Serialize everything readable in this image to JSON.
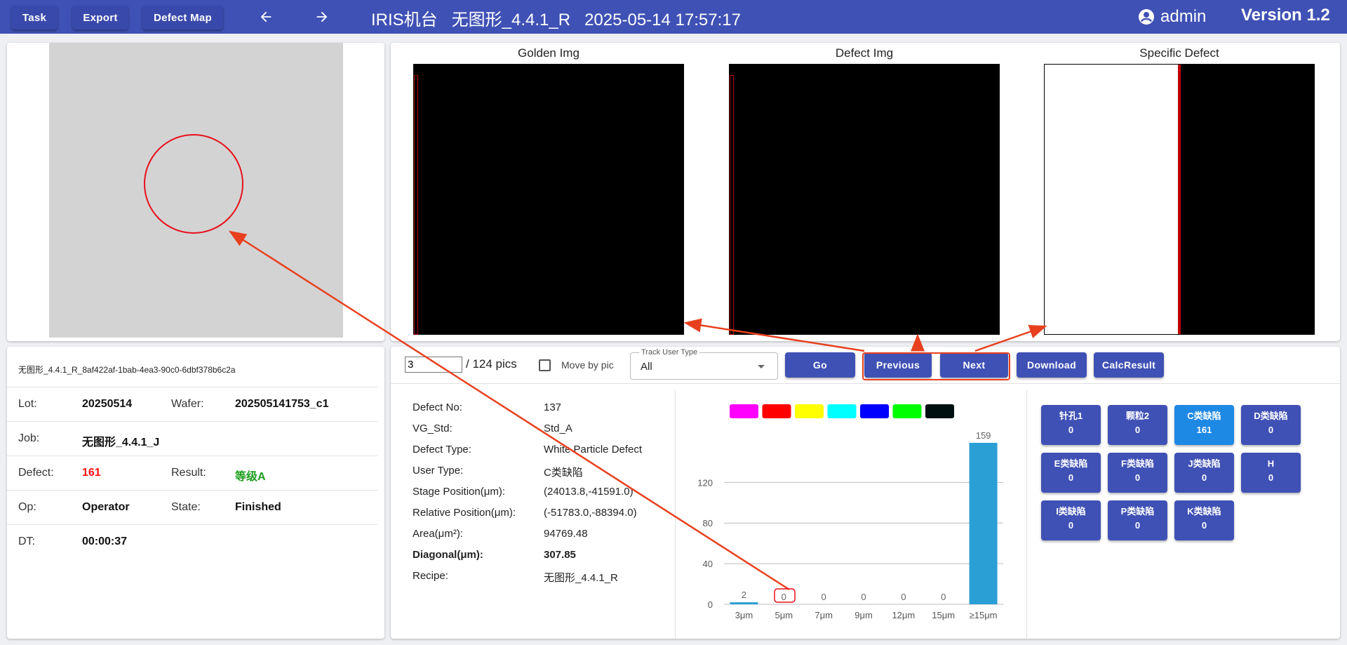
{
  "topbar": {
    "task_label": "Task",
    "export_label": "Export",
    "defect_map_label": "Defect Map",
    "title": "IRIS机台   无图形_4.4.1_R   2025-05-14 17:57:17",
    "user": "admin",
    "version": "Version 1.2"
  },
  "images": {
    "golden_title": "Golden Img",
    "defect_title": "Defect Img",
    "specific_title": "Specific Defect"
  },
  "info": {
    "file_id": "无图形_4.4.1_R_8af422af-1bab-4ea3-90c0-6dbf378b6c2a",
    "lot_label": "Lot:",
    "lot": "20250514",
    "wafer_label": "Wafer:",
    "wafer": "202505141753_c1",
    "job_label": "Job:",
    "job": "无图形_4.4.1_J",
    "defect_label": "Defect:",
    "defect": "161",
    "result_label": "Result:",
    "result": "等级A",
    "op_label": "Op:",
    "op": "Operator",
    "state_label": "State:",
    "state": "Finished",
    "dt_label": "DT:",
    "dt": "00:00:37"
  },
  "controls": {
    "page_value": "3",
    "total_label": "/ 124 pics",
    "move_by_pic_label": "Move by pic",
    "track_user_type_label": "Track User Type",
    "track_user_type_value": "All",
    "go_label": "Go",
    "previous_label": "Previous",
    "next_label": "Next",
    "download_label": "Download",
    "calc_label": "CalcResult"
  },
  "defect": {
    "no_label": "Defect No:",
    "no": "137",
    "vg_label": "VG_Std:",
    "vg": "Std_A",
    "type_label": "Defect Type:",
    "type": "White Particle Defect",
    "user_type_label": "User Type:",
    "user_type": "C类缺陷",
    "stage_label": "Stage Position(μm):",
    "stage": "(24013.8,-41591.0)",
    "relative_label": "Relative Position(μm):",
    "relative": "(-51783.0,-88394.0)",
    "area_label": "Area(μm²):",
    "area": "94769.48",
    "diagonal_label": "Diagonal(μm):",
    "diagonal": "307.85",
    "recipe_label": "Recipe:",
    "recipe": "无图形_4.4.1_R"
  },
  "chart_data": {
    "type": "bar",
    "categories": [
      "3μm",
      "5μm",
      "7μm",
      "9μm",
      "12μm",
      "15μm",
      "≥15μm"
    ],
    "values": [
      2,
      0,
      0,
      0,
      0,
      0,
      159
    ],
    "yticks": [
      0,
      40,
      80,
      120
    ],
    "ylim": [
      0,
      170
    ],
    "bar_color": "#2a9fd6",
    "legend_colors": [
      "#ff00ff",
      "#ff0000",
      "#ffff00",
      "#00ffff",
      "#0000ff",
      "#00ff00",
      "#001010"
    ],
    "title": "",
    "xlabel": "",
    "ylabel": ""
  },
  "categories": [
    {
      "label": "针孔1",
      "count": "0",
      "active": false
    },
    {
      "label": "颗粒2",
      "count": "0",
      "active": false
    },
    {
      "label": "C类缺陷",
      "count": "161",
      "active": true
    },
    {
      "label": "D类缺陷",
      "count": "0",
      "active": false
    },
    {
      "label": "E类缺陷",
      "count": "0",
      "active": false
    },
    {
      "label": "F类缺陷",
      "count": "0",
      "active": false
    },
    {
      "label": "J类缺陷",
      "count": "0",
      "active": false
    },
    {
      "label": "H",
      "count": "0",
      "active": false
    },
    {
      "label": "I类缺陷",
      "count": "0",
      "active": false
    },
    {
      "label": "P类缺陷",
      "count": "0",
      "active": false
    },
    {
      "label": "K类缺陷",
      "count": "0",
      "active": false
    }
  ]
}
